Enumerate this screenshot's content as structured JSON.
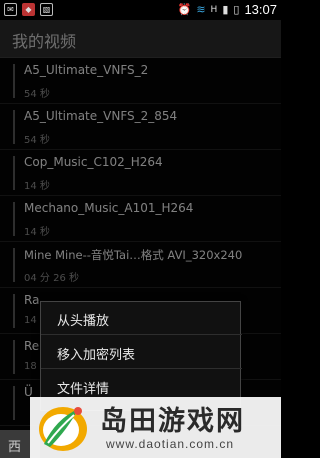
{
  "status_bar": {
    "icons": [
      "mail-icon",
      "shield-icon",
      "photo-icon",
      "alarm-icon",
      "wifi-icon",
      "signal-icon",
      "battery-icon"
    ],
    "network": "H",
    "time": "13:07"
  },
  "header": {
    "title": "我的视频"
  },
  "videos": [
    {
      "name": "A5_Ultimate_VNFS_2",
      "duration": "54 秒"
    },
    {
      "name": "A5_Ultimate_VNFS_2_854",
      "duration": "54 秒"
    },
    {
      "name": "Cop_Music_C102_H264",
      "duration": "14 秒"
    },
    {
      "name": "Mechano_Music_A101_H264",
      "duration": "14 秒"
    },
    {
      "name": "Mine Mine--音悦Tai…格式 AVI_320x240",
      "duration": "04 分 26 秒"
    },
    {
      "name": "Ra",
      "duration": "14"
    },
    {
      "name": "Re",
      "duration": "18"
    },
    {
      "name": "Ü",
      "duration": ""
    }
  ],
  "context_menu": {
    "items": [
      "从头播放",
      "移入加密列表",
      "文件详情"
    ]
  },
  "bottom_tab": {
    "label": "西"
  },
  "watermark": {
    "text": "岛田游戏网",
    "url": "www.daotian.com.cn"
  },
  "colors": {
    "background": "#050505",
    "title_bar": "#2b2b2b",
    "menu": "#111111",
    "accent_logo": "#f2a900"
  }
}
